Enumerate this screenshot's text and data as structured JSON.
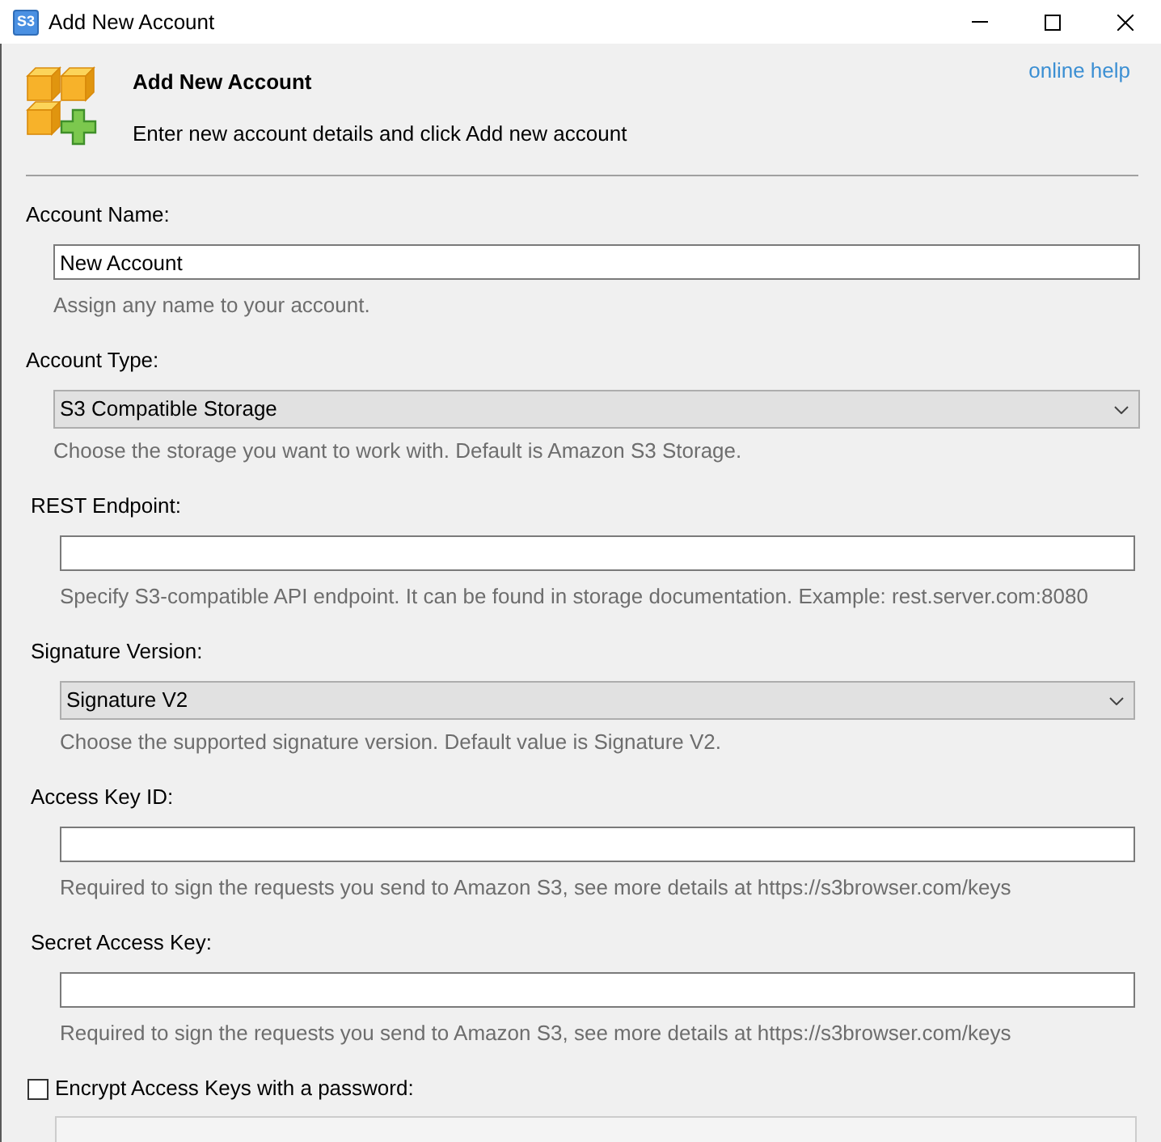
{
  "window": {
    "icon_label": "S3",
    "title": "Add New Account"
  },
  "header": {
    "title": "Add New Account",
    "subtitle": "Enter new account details and click Add new account",
    "help_link": "online help"
  },
  "account_fields": [
    {
      "kind": "text",
      "label": "Account Name:",
      "value": "New Account",
      "hint": "Assign any name to your account."
    },
    {
      "kind": "select",
      "label": "Account Type:",
      "value": "S3 Compatible Storage",
      "hint": "Choose the storage you want to work with. Default is Amazon S3 Storage."
    }
  ],
  "storage_fields": [
    {
      "kind": "text",
      "label": "REST Endpoint:",
      "hint": "Specify S3-compatible API endpoint. It can be found in storage documentation. Example: rest.server.com:8080"
    },
    {
      "kind": "select",
      "label": "Signature Version:",
      "value": "Signature V2",
      "hint": "Choose the supported signature version. Default value is Signature V2."
    },
    {
      "kind": "text",
      "label": "Access Key ID:",
      "hint": "Required to sign the requests you send to Amazon S3, see more details at https://s3browser.com/keys"
    },
    {
      "kind": "text",
      "label": "Secret Access Key:",
      "hint": "Required to sign the requests you send to Amazon S3, see more details at https://s3browser.com/keys"
    }
  ],
  "encrypt_option": {
    "label": "Encrypt Access Keys with a password:",
    "checked": false
  },
  "password_field": {
    "disabled": true
  }
}
